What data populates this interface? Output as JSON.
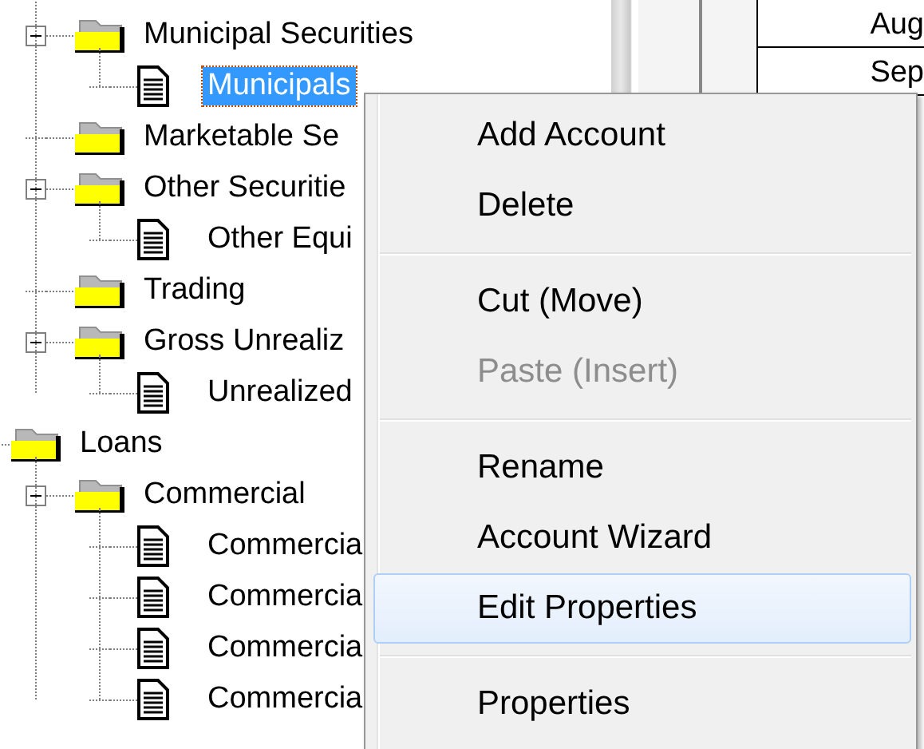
{
  "tree": {
    "nodes": [
      {
        "children": [
          {
            "label": "Municipal Securities",
            "kind": "folder",
            "expanded": true,
            "selected": false,
            "children": [
              {
                "label": "Municipals",
                "kind": "document",
                "selected": true
              }
            ]
          },
          {
            "label": "Marketable Se",
            "kind": "folder",
            "selected": false
          },
          {
            "label": "Other Securitie",
            "kind": "folder",
            "expanded": true,
            "selected": false,
            "children": [
              {
                "label": "Other Equi",
                "kind": "document",
                "selected": false
              }
            ]
          },
          {
            "label": "Trading",
            "kind": "folder",
            "selected": false
          },
          {
            "label": "Gross Unrealiz",
            "kind": "folder",
            "expanded": true,
            "selected": false,
            "children": [
              {
                "label": "Unrealized",
                "kind": "document",
                "selected": false
              }
            ]
          }
        ]
      },
      {
        "label": "Loans",
        "kind": "folder",
        "selected": false,
        "children": [
          {
            "label": "Commercial",
            "kind": "folder",
            "expanded": true,
            "selected": false,
            "children": [
              {
                "label": "Commercia",
                "kind": "document",
                "selected": false
              },
              {
                "label": "Commercia",
                "kind": "document",
                "selected": false
              },
              {
                "label": "Commercia",
                "kind": "document",
                "selected": false
              },
              {
                "label": "Commercia",
                "kind": "document",
                "selected": false
              }
            ]
          }
        ]
      }
    ]
  },
  "table": {
    "rows": [
      "Aug",
      "Sep"
    ]
  },
  "context_menu": {
    "items": [
      {
        "kind": "item",
        "label": "Add Account",
        "disabled": false,
        "selected": false
      },
      {
        "kind": "item",
        "label": "Delete",
        "disabled": false,
        "selected": false
      },
      {
        "kind": "separator"
      },
      {
        "kind": "item",
        "label": "Cut (Move)",
        "disabled": false,
        "selected": false
      },
      {
        "kind": "item",
        "label": "Paste (Insert)",
        "disabled": true,
        "selected": false
      },
      {
        "kind": "separator"
      },
      {
        "kind": "item",
        "label": "Rename",
        "disabled": false,
        "selected": false
      },
      {
        "kind": "item",
        "label": "Account Wizard",
        "disabled": false,
        "selected": false
      },
      {
        "kind": "item",
        "label": "Edit Properties",
        "disabled": false,
        "selected": true
      },
      {
        "kind": "separator"
      },
      {
        "kind": "item",
        "label": "Properties",
        "disabled": false,
        "selected": false
      }
    ]
  }
}
